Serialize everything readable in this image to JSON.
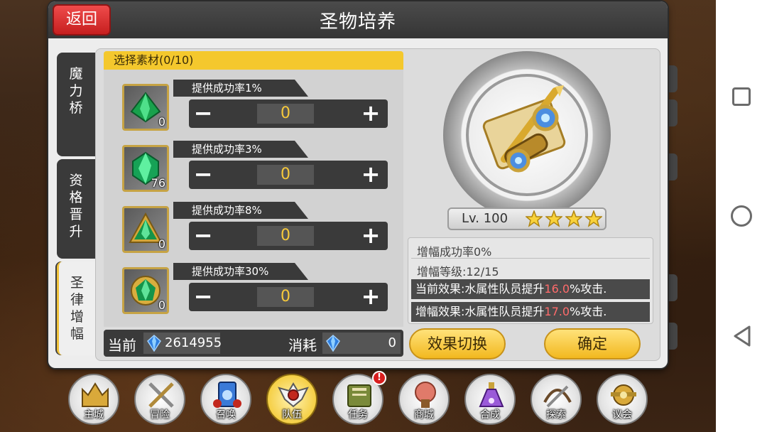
{
  "header": {
    "title": "圣物培养",
    "back_label": "返回"
  },
  "tabs": [
    {
      "label": "魔力桥",
      "active": false
    },
    {
      "label": "资格晋升",
      "active": false
    },
    {
      "label": "圣律增幅",
      "active": true
    }
  ],
  "materials": {
    "header": "选择素材(0/10)",
    "items": [
      {
        "label": "提供成功率1%",
        "count": "0",
        "value": "0",
        "icon": "small-green-crystal-icon"
      },
      {
        "label": "提供成功率3%",
        "count": "76",
        "value": "0",
        "icon": "medium-green-crystal-icon"
      },
      {
        "label": "提供成功率8%",
        "count": "0",
        "value": "0",
        "icon": "framed-green-crystal-icon"
      },
      {
        "label": "提供成功率30%",
        "count": "0",
        "value": "0",
        "icon": "gold-green-crystal-icon"
      }
    ],
    "minus_symbol": "−",
    "plus_symbol": "+"
  },
  "currency": {
    "current_label": "当前",
    "current_value": "2614955",
    "cost_label": "消耗",
    "cost_value": "0",
    "icon": "blue-crystal-icon"
  },
  "relic": {
    "icon": "golden-scroll-telescope-icon",
    "level": "Lv. 100",
    "stars": 4
  },
  "stats": {
    "success_rate": "增幅成功率0%",
    "level": "增幅等级:12/15",
    "current_effect_prefix": "当前效果:水属性队员提升",
    "current_effect_value": "16.0",
    "current_effect_suffix": "%攻击.",
    "amp_effect_prefix": "增幅效果:水属性队员提升",
    "amp_effect_value": "17.0",
    "amp_effect_suffix": "%攻击."
  },
  "buttons": {
    "switch": "效果切换",
    "confirm": "确定"
  },
  "bottom_menu": [
    {
      "label": "主城",
      "icon": "crown-castle-icon"
    },
    {
      "label": "冒险",
      "icon": "crossed-swords-icon"
    },
    {
      "label": "召唤",
      "icon": "summon-card-icon"
    },
    {
      "label": "队伍",
      "icon": "winged-emblem-icon",
      "active": true
    },
    {
      "label": "任务",
      "icon": "quest-book-icon",
      "badge": "!"
    },
    {
      "label": "商城",
      "icon": "shop-tree-icon"
    },
    {
      "label": "合成",
      "icon": "potion-flask-icon"
    },
    {
      "label": "探索",
      "icon": "explore-crossbow-icon"
    },
    {
      "label": "议会",
      "icon": "council-crest-icon"
    }
  ],
  "colors": {
    "accent_gold": "#f4c82d",
    "back_red": "#d92f2f",
    "highlight_red": "#ff6b6b",
    "dark_panel": "#3a3a3a"
  }
}
